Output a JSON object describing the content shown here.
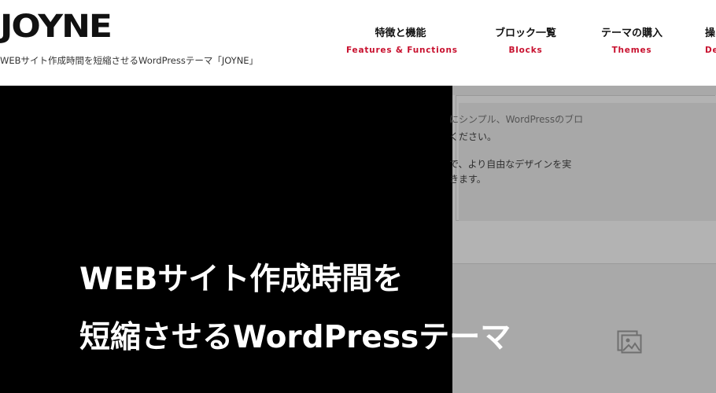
{
  "header": {
    "logo": "JOYNE",
    "tagline": "WEBサイト作成時間を短縮させるWordPressテーマ「JOYNE」"
  },
  "nav": {
    "items": [
      {
        "ja": "特徴と機能",
        "en": "Features & Functions"
      },
      {
        "ja": "ブロック一覧",
        "en": "Blocks"
      },
      {
        "ja": "テーマの購入",
        "en": "Themes"
      },
      {
        "ja": "操",
        "en": "De"
      }
    ]
  },
  "hero": {
    "title_line1": "WEBサイト作成時間を",
    "title_line2": "短縮させるWordPressテーマ",
    "screenshot_lines": [
      "にシンプル、WordPressのブロ",
      "ください。",
      "で、より自由なデザインを実",
      "きます。"
    ],
    "icon": "image-placeholder-icon"
  },
  "colors": {
    "accent": "#c8102e",
    "hero_bg": "#000000",
    "screenshot_bg": "#a9a9a9"
  }
}
